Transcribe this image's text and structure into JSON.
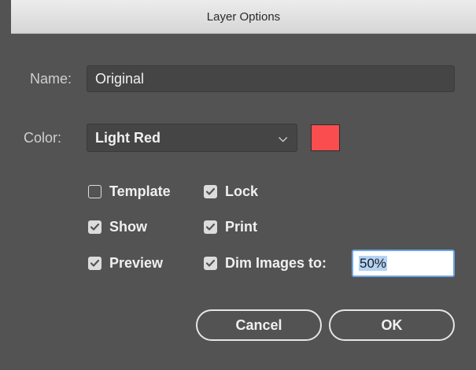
{
  "dialog": {
    "title": "Layer Options"
  },
  "name": {
    "label": "Name:",
    "value": "Original"
  },
  "color": {
    "label": "Color:",
    "selected": "Light Red",
    "swatch_color": "#fa4d4f"
  },
  "options": {
    "template": {
      "label": "Template",
      "checked": false
    },
    "lock": {
      "label": "Lock",
      "checked": true
    },
    "show": {
      "label": "Show",
      "checked": true
    },
    "print": {
      "label": "Print",
      "checked": true
    },
    "preview": {
      "label": "Preview",
      "checked": true
    },
    "dim_images": {
      "label": "Dim Images to:",
      "checked": true,
      "value": "50%"
    }
  },
  "buttons": {
    "cancel": "Cancel",
    "ok": "OK"
  }
}
